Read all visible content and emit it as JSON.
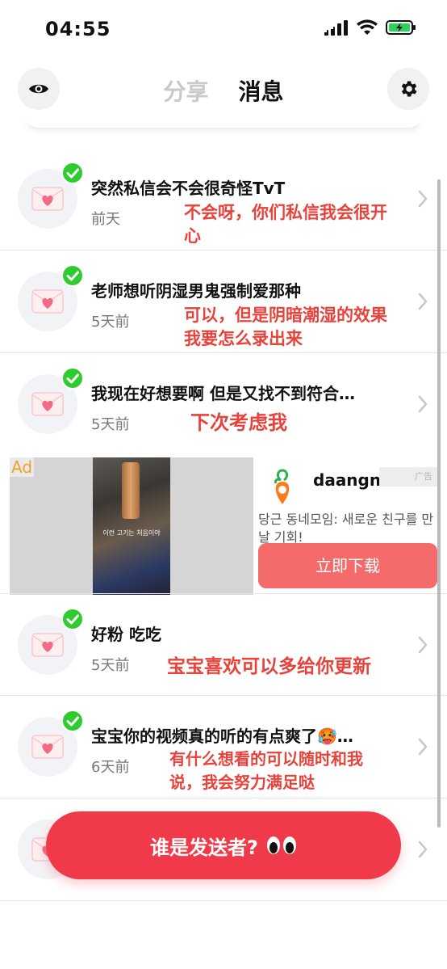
{
  "status_bar": {
    "time": "04:55"
  },
  "header": {
    "tab_share": "分享",
    "tab_messages": "消息",
    "left_icon": "eye-icon",
    "right_icon": "gear-icon"
  },
  "messages": [
    {
      "title": "突然私信会不会很奇怪TvT",
      "time": "前天",
      "note": "不会呀，你们私信我会很开心"
    },
    {
      "title": "老师想听阴湿男鬼强制爱那种",
      "time": "5天前",
      "note": "可以，但是阴暗潮湿的效果我要怎么录出来"
    },
    {
      "title": "我现在好想要啊 但是又找不到符合…",
      "time": "5天前",
      "note": "下次考虑我"
    },
    {
      "title": "好粉 吃吃",
      "time": "5天前",
      "note": "宝宝喜欢可以多给你更新"
    },
    {
      "title": "宝宝你的视频真的听的有点爽了🥵…",
      "time": "6天前",
      "note": "有什么想看的可以随时和我说，我会努力满足哒"
    }
  ],
  "ad": {
    "label": "Ad",
    "brand": "daangn",
    "tag": "广告",
    "description": "당근 동네모임: 새로운 친구를 만날 기회!",
    "cta": "立即下载",
    "image_caption": "이런 고기는 처음이야"
  },
  "bottom_cta": {
    "label": "谁是发送者?"
  },
  "colors": {
    "accent_red": "#f03a4a",
    "note_red": "#e8423b",
    "check_green": "#2ecc2e",
    "ad_button": "#f36b6b"
  }
}
